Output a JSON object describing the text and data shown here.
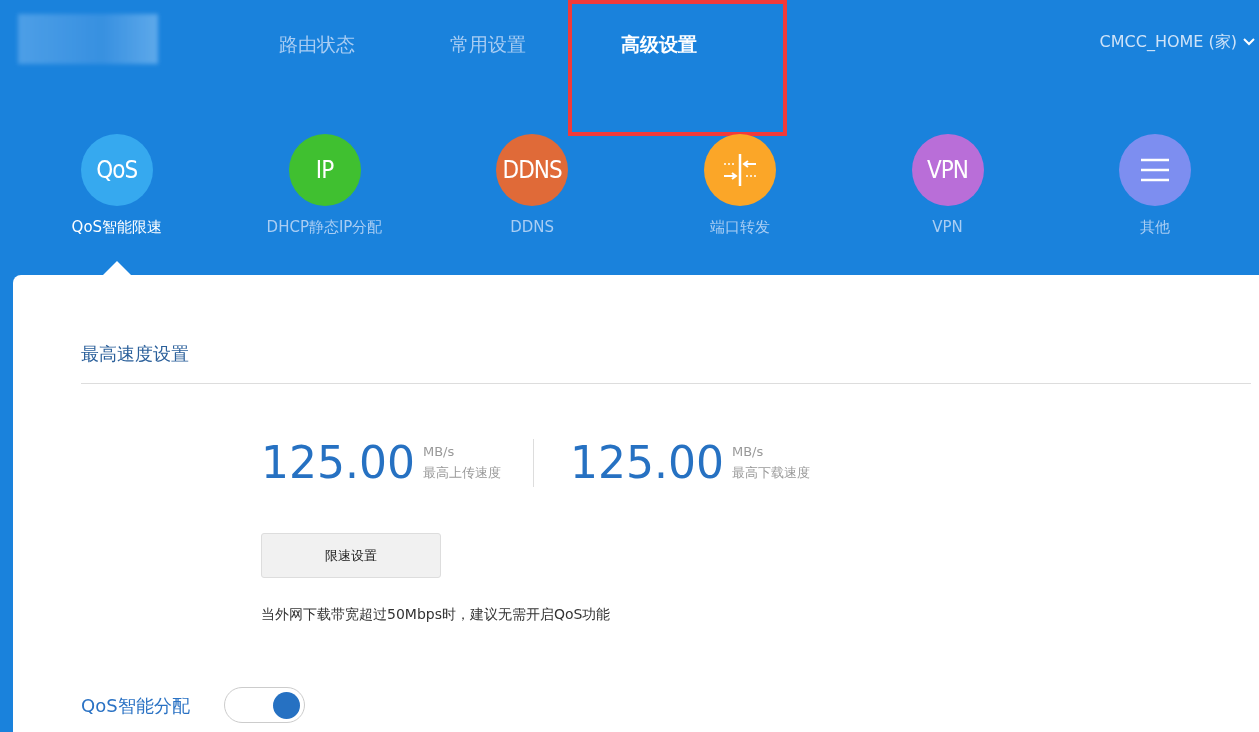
{
  "top_nav": {
    "tabs": [
      {
        "label": "路由状态",
        "selected": false,
        "highlighted": false
      },
      {
        "label": "常用设置",
        "selected": false,
        "highlighted": false
      },
      {
        "label": "高级设置",
        "selected": true,
        "highlighted": true
      }
    ],
    "network": "CMCC_HOME (家)"
  },
  "features": [
    {
      "label": "QoS智能限速",
      "kind": "text",
      "icon_text": "QoS",
      "color": "#36a9ef",
      "selected": true
    },
    {
      "label": "DHCP静态IP分配",
      "kind": "text",
      "icon_text": "IP",
      "color": "#40c030",
      "selected": false
    },
    {
      "label": "DDNS",
      "kind": "text",
      "icon_text": "DDNS",
      "color": "#e06a38",
      "selected": false
    },
    {
      "label": "端口转发",
      "kind": "port",
      "color": "#fba628",
      "selected": false
    },
    {
      "label": "VPN",
      "kind": "text",
      "icon_text": "VPN",
      "color": "#b96ed8",
      "selected": false
    },
    {
      "label": "其他",
      "kind": "menu",
      "color": "#7d8ef0",
      "selected": false
    }
  ],
  "section": {
    "title": "最高速度设置",
    "stats": [
      {
        "value": "125.00",
        "unit": "MB/s",
        "caption": "最高上传速度"
      },
      {
        "value": "125.00",
        "unit": "MB/s",
        "caption": "最高下载速度"
      }
    ],
    "button": "限速设置",
    "note": "当外网下载带宽超过50Mbps时，建议无需开启QoS功能"
  },
  "qos_toggle": {
    "label": "QoS智能分配",
    "on": true
  }
}
